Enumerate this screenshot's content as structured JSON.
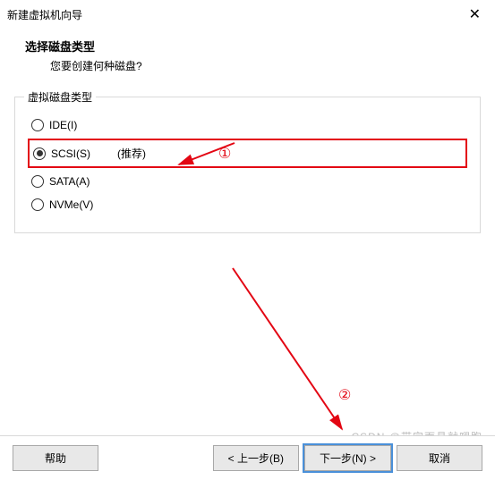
{
  "titlebar": {
    "title": "新建虚拟机向导"
  },
  "page": {
    "heading": "选择磁盘类型",
    "subheading": "您要创建何种磁盘?"
  },
  "fieldset": {
    "legend": "虚拟磁盘类型",
    "options": [
      {
        "label": "IDE(I)",
        "selected": false,
        "suffix": ""
      },
      {
        "label": "SCSI(S)",
        "selected": true,
        "suffix": "(推荐)"
      },
      {
        "label": "SATA(A)",
        "selected": false,
        "suffix": ""
      },
      {
        "label": "NVMe(V)",
        "selected": false,
        "suffix": ""
      }
    ]
  },
  "footer": {
    "help": "帮助",
    "back": "< 上一步(B)",
    "next": "下一步(N) >",
    "cancel": "取消"
  },
  "annotations": {
    "a1": "①",
    "a2": "②"
  },
  "watermark": "CSDN @带完面具就嘚跑"
}
